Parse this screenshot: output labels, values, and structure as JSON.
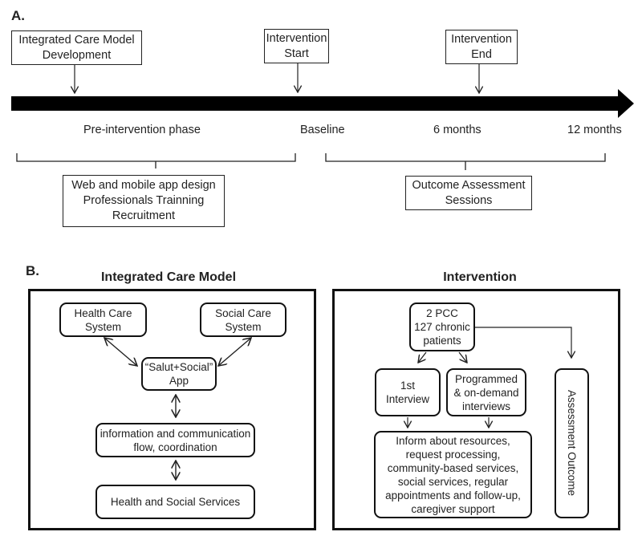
{
  "panel_a": {
    "letter": "A.",
    "milestones": [
      {
        "id": "icm-dev",
        "text": "Integrated Care Model\nDevelopment"
      },
      {
        "id": "int-start",
        "text": "Intervention\nStart"
      },
      {
        "id": "int-end",
        "text": "Intervention\nEnd"
      }
    ],
    "timeline_labels": [
      "Pre-intervention phase",
      "Baseline",
      "6 months",
      "12 months"
    ],
    "brackets": [
      {
        "id": "pre",
        "text": "Web and mobile app design\nProfessionals Trainning\nRecruitment"
      },
      {
        "id": "post",
        "text": "Outcome Assessment\nSessions"
      }
    ]
  },
  "panel_b": {
    "letter": "B.",
    "left": {
      "title": "Integrated Care Model",
      "nodes": {
        "health_care": "Health Care\nSystem",
        "social_care": "Social Care\nSystem",
        "app": "“Salut+Social”\nApp",
        "info_flow": "information and communication\nflow, coordination",
        "services": "Health and Social Services"
      }
    },
    "right": {
      "title": "Intervention",
      "nodes": {
        "pcc": "2 PCC\n127 chronic\npatients",
        "first_interview": "1st\nInterview",
        "programmed": "Programmed\n& on-demand\ninterviews",
        "inform": "Inform about resources,\nrequest processing,\ncommunity-based services,\nsocial services, regular\nappointments and follow-up,\ncaregiver  support",
        "assessment": "Assessment Outcome"
      }
    }
  }
}
